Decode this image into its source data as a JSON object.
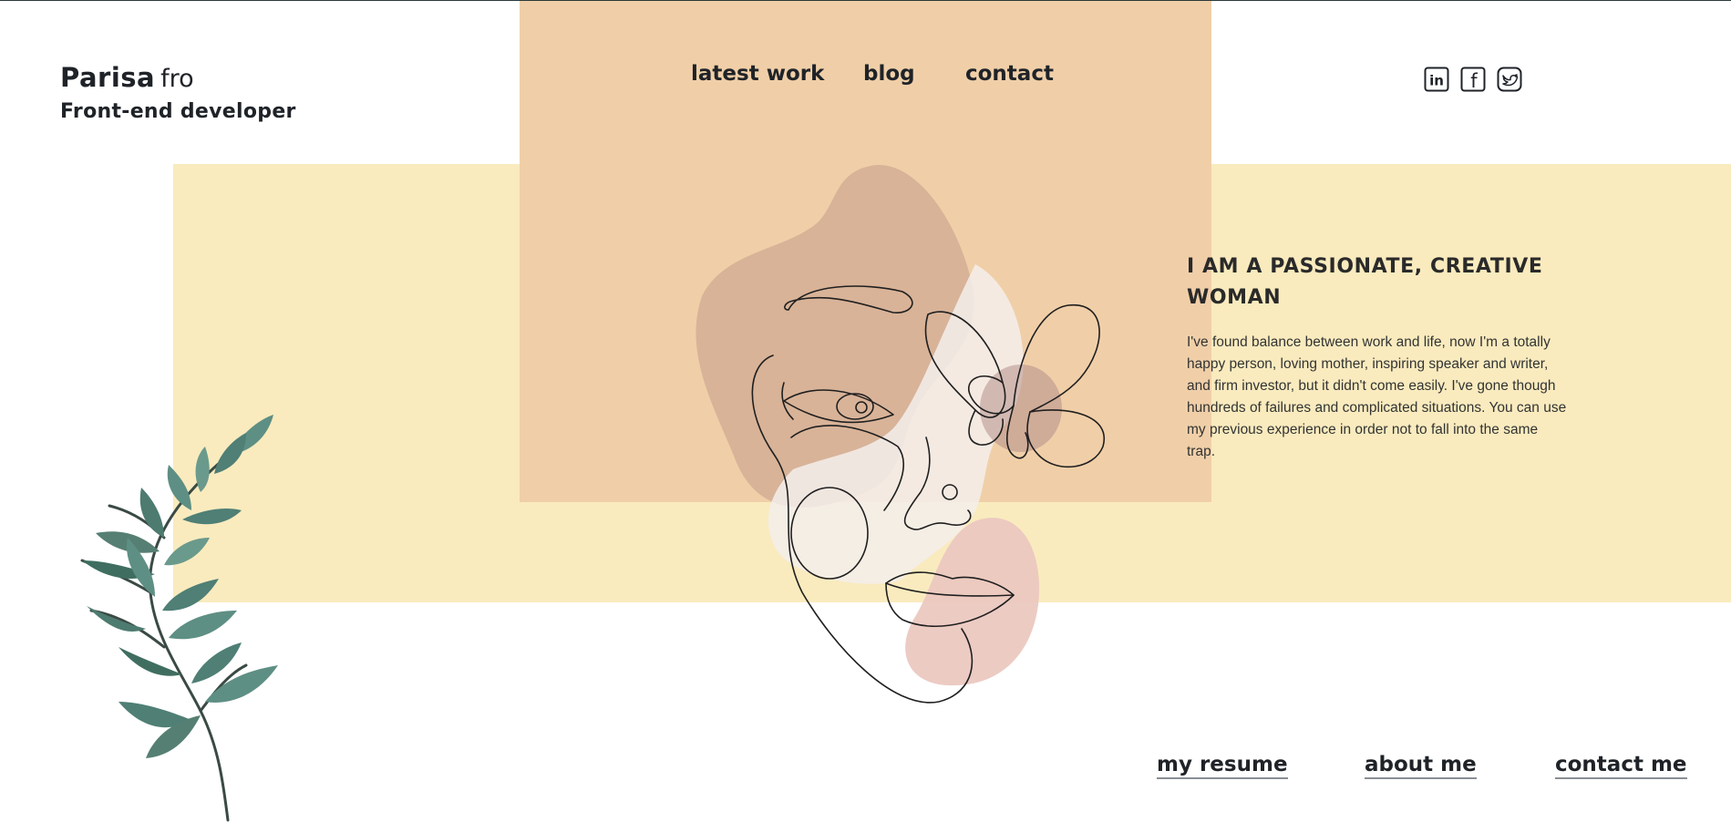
{
  "brand": {
    "name": "Parisa",
    "suffix": "fro",
    "role": "Front-end developer"
  },
  "nav": {
    "items": [
      "latest work",
      "blog",
      "contact"
    ]
  },
  "social": {
    "icons": [
      "linkedin-icon",
      "facebook-icon",
      "twitter-icon"
    ],
    "linkedin_letters": "in",
    "facebook_letter": "f"
  },
  "hero": {
    "heading": "I AM A PASSIONATE, CREATIVE WOMAN",
    "body": "I've found balance between work and life, now I'm a totally happy person, loving mother, inspiring speaker and writer, and firm investor, but it didn't come easily. I've gone though hundreds of failures and complicated situations. You can use my previous experience in order not to fall into the same trap."
  },
  "bottom_links": [
    "my resume",
    "about me",
    "contact me"
  ],
  "colors": {
    "peach": "#f0cfa8",
    "yellow": "#f9ebbe",
    "face_tan": "#d6b197",
    "face_light": "#f5efec",
    "blush": "#ebc8c0",
    "butterfly_spot": "#b48f8a",
    "text": "#1f2328"
  }
}
